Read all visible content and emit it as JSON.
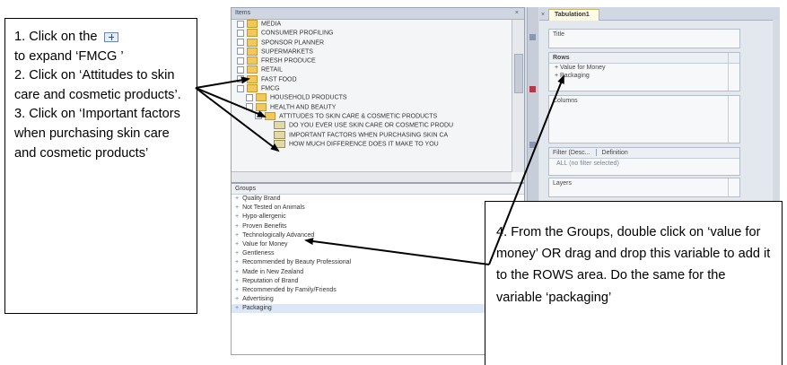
{
  "instructions": {
    "step1_before_icon": "1. Click on the",
    "step1_after_icon": "to expand ‘FMCG ’",
    "step2": "2. Click on ‘Attitudes to skin care and cosmetic products’.",
    "step3": "3. Click on ‘Important factors when purchasing skin care and cosmetic products’",
    "step4": "4. From the Groups, double click on ‘value for money’ OR drag and drop this variable to add it to the ROWS area. Do the same for the variable ‘packaging’"
  },
  "app": {
    "tree_panel_title": "Items",
    "tree_panel_close": "×",
    "tree_items": [
      {
        "label": "MEDIA",
        "indent": 0,
        "icon": "folder-icon"
      },
      {
        "label": "CONSUMER PROFILING",
        "indent": 0,
        "icon": "folder-icon"
      },
      {
        "label": "SPONSOR PLANNER",
        "indent": 0,
        "icon": "folder-icon"
      },
      {
        "label": "SUPERMARKETS",
        "indent": 0,
        "icon": "folder-icon"
      },
      {
        "label": "FRESH PRODUCE",
        "indent": 0,
        "icon": "folder-icon"
      },
      {
        "label": "RETAIL",
        "indent": 0,
        "icon": "folder-icon"
      },
      {
        "label": "FAST FOOD",
        "indent": 0,
        "icon": "folder-icon"
      },
      {
        "label": "FMCG",
        "indent": 0,
        "icon": "folder-icon"
      },
      {
        "label": "HOUSEHOLD PRODUCTS",
        "indent": 1,
        "icon": "folder-icon"
      },
      {
        "label": "HEALTH AND BEAUTY",
        "indent": 1,
        "icon": "folder-icon"
      },
      {
        "label": "ATTITUDES TO SKIN CARE & COSMETIC PRODUCTS",
        "indent": 2,
        "icon": "folder-icon"
      },
      {
        "label": "DO YOU EVER USE SKIN CARE OR COSMETIC PRODU",
        "indent": 3,
        "icon": "variable-icon"
      },
      {
        "label": "IMPORTANT FACTORS WHEN PURCHASING SKIN CA",
        "indent": 3,
        "icon": "variable-icon"
      },
      {
        "label": "HOW MUCH DIFFERENCE DOES IT MAKE TO YOU",
        "indent": 3,
        "icon": "variable-icon"
      }
    ],
    "groups_title": "Groups",
    "groups": [
      "Quality Brand",
      "Not Tested on Animals",
      "Hypo-allergenic",
      "Proven Benefits",
      "Technologically Advanced",
      "Value for Money",
      "Gentleness",
      "Recommended by Beauty Professional",
      "Made in New Zealand",
      "Reputation of Brand",
      "Recommended by Family/Friends",
      "Advertising",
      "Packaging"
    ],
    "selected_group": "Packaging",
    "tab_label": "Tabulation1",
    "tab_close": "×",
    "title_box_label": "Title",
    "rows_label": "Rows",
    "rows_items": [
      "Value for Money",
      "Packaging"
    ],
    "columns_label": "Columns",
    "filter_label": "Filter (Desc...",
    "filter_definition_label": "Definition",
    "filter_value": "ALL (no filter selected)",
    "layers_label": "Layers"
  }
}
